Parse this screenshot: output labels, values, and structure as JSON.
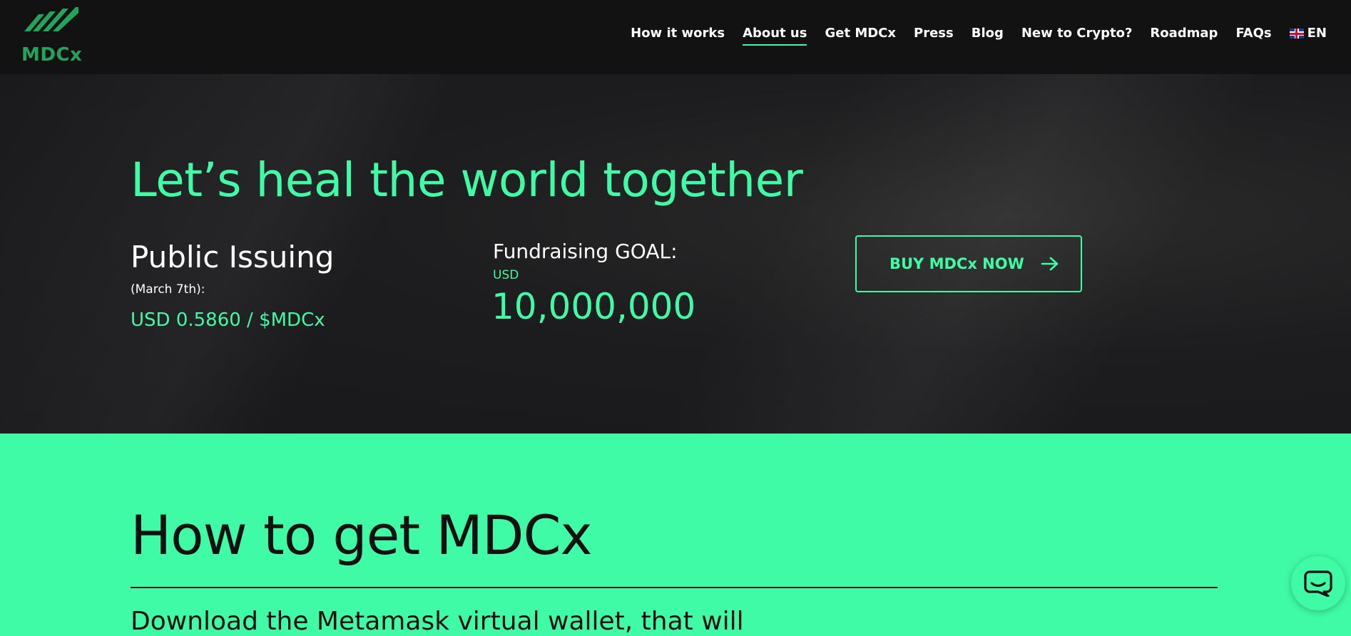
{
  "header": {
    "logo_text": "MDCx",
    "nav": [
      {
        "label": "How it works",
        "active": false
      },
      {
        "label": "About us",
        "active": true
      },
      {
        "label": "Get MDCx",
        "active": false
      },
      {
        "label": "Press",
        "active": false
      },
      {
        "label": "Blog",
        "active": false
      },
      {
        "label": "New to Crypto?",
        "active": false
      },
      {
        "label": "Roadmap",
        "active": false
      },
      {
        "label": "FAQs",
        "active": false
      }
    ],
    "language": {
      "label": "EN",
      "flag_icon": "uk-flag-icon"
    }
  },
  "hero": {
    "title": "Let’s heal the world together",
    "issuing": {
      "title": "Public Issuing",
      "date": "(March 7th):",
      "price": "USD 0.5860 / $MDCx"
    },
    "goal": {
      "title": "Fundraising GOAL:",
      "currency": "USD",
      "amount": "10,000,000"
    },
    "buy_button": {
      "label": "BUY MDCx NOW",
      "icon": "arrow-right-icon"
    }
  },
  "section": {
    "title": "How to get MDCx",
    "intro": "Download the Metamask virtual wallet, that will"
  },
  "chat": {
    "icon": "chat-bubble-icon"
  },
  "colors": {
    "accent": "#3ffba5",
    "header_bg": "#121212",
    "hero_bg": "#1d1d1f",
    "logo_green": "#22a45d",
    "text_dark": "#111111"
  }
}
